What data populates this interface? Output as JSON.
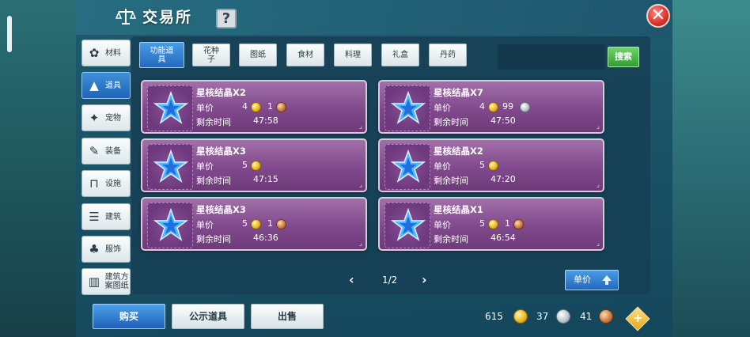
{
  "header": {
    "title": "交易所",
    "help_label": "?",
    "close_label": "✕"
  },
  "categories": [
    {
      "label": "材料",
      "icon": "materials-icon",
      "glyph": "✿"
    },
    {
      "label": "道具",
      "icon": "item-icon",
      "glyph": "▲"
    },
    {
      "label": "宠物",
      "icon": "paw-icon",
      "glyph": "✦"
    },
    {
      "label": "装备",
      "icon": "equipment-icon",
      "glyph": "✎"
    },
    {
      "label": "设施",
      "icon": "facility-icon",
      "glyph": "⊓"
    },
    {
      "label": "建筑",
      "icon": "building-icon",
      "glyph": "☰"
    },
    {
      "label": "服饰",
      "icon": "clothing-icon",
      "glyph": "♣"
    },
    {
      "label": "建筑方案图纸",
      "icon": "blueprint-icon",
      "glyph": "▥"
    }
  ],
  "active_category": "道具",
  "tabs": [
    "功能道具",
    "花种子",
    "图纸",
    "食材",
    "料理",
    "礼盒",
    "丹药"
  ],
  "active_tab": "功能道具",
  "search": {
    "button_label": "搜索"
  },
  "listing_labels": {
    "price": "单价",
    "time_left": "剩余时间"
  },
  "listings": [
    {
      "name": "星核结晶X2",
      "gold": "4",
      "silver": "",
      "copper": "1",
      "time": "47:58"
    },
    {
      "name": "星核结晶X7",
      "gold": "4",
      "silver": "99",
      "copper": "",
      "time": "47:50"
    },
    {
      "name": "星核结晶X3",
      "gold": "5",
      "silver": "",
      "copper": "",
      "time": "47:15"
    },
    {
      "name": "星核结晶X2",
      "gold": "5",
      "silver": "",
      "copper": "",
      "time": "47:20"
    },
    {
      "name": "星核结晶X3",
      "gold": "5",
      "silver": "",
      "copper": "1",
      "time": "46:36"
    },
    {
      "name": "星核结晶X1",
      "gold": "5",
      "silver": "",
      "copper": "1",
      "time": "46:54"
    }
  ],
  "pagination": {
    "prev": "‹",
    "label": "1/2",
    "next": "›"
  },
  "sort": {
    "label": "单价",
    "icon": "sort-up-icon"
  },
  "bottom": {
    "buy": "购买",
    "public": "公示道具",
    "sell": "出售"
  },
  "currency": {
    "gold": "615",
    "silver": "37",
    "copper": "41"
  },
  "colors": {
    "accent": "#2369be",
    "card": "#80498c",
    "search": "#2f9d33"
  }
}
